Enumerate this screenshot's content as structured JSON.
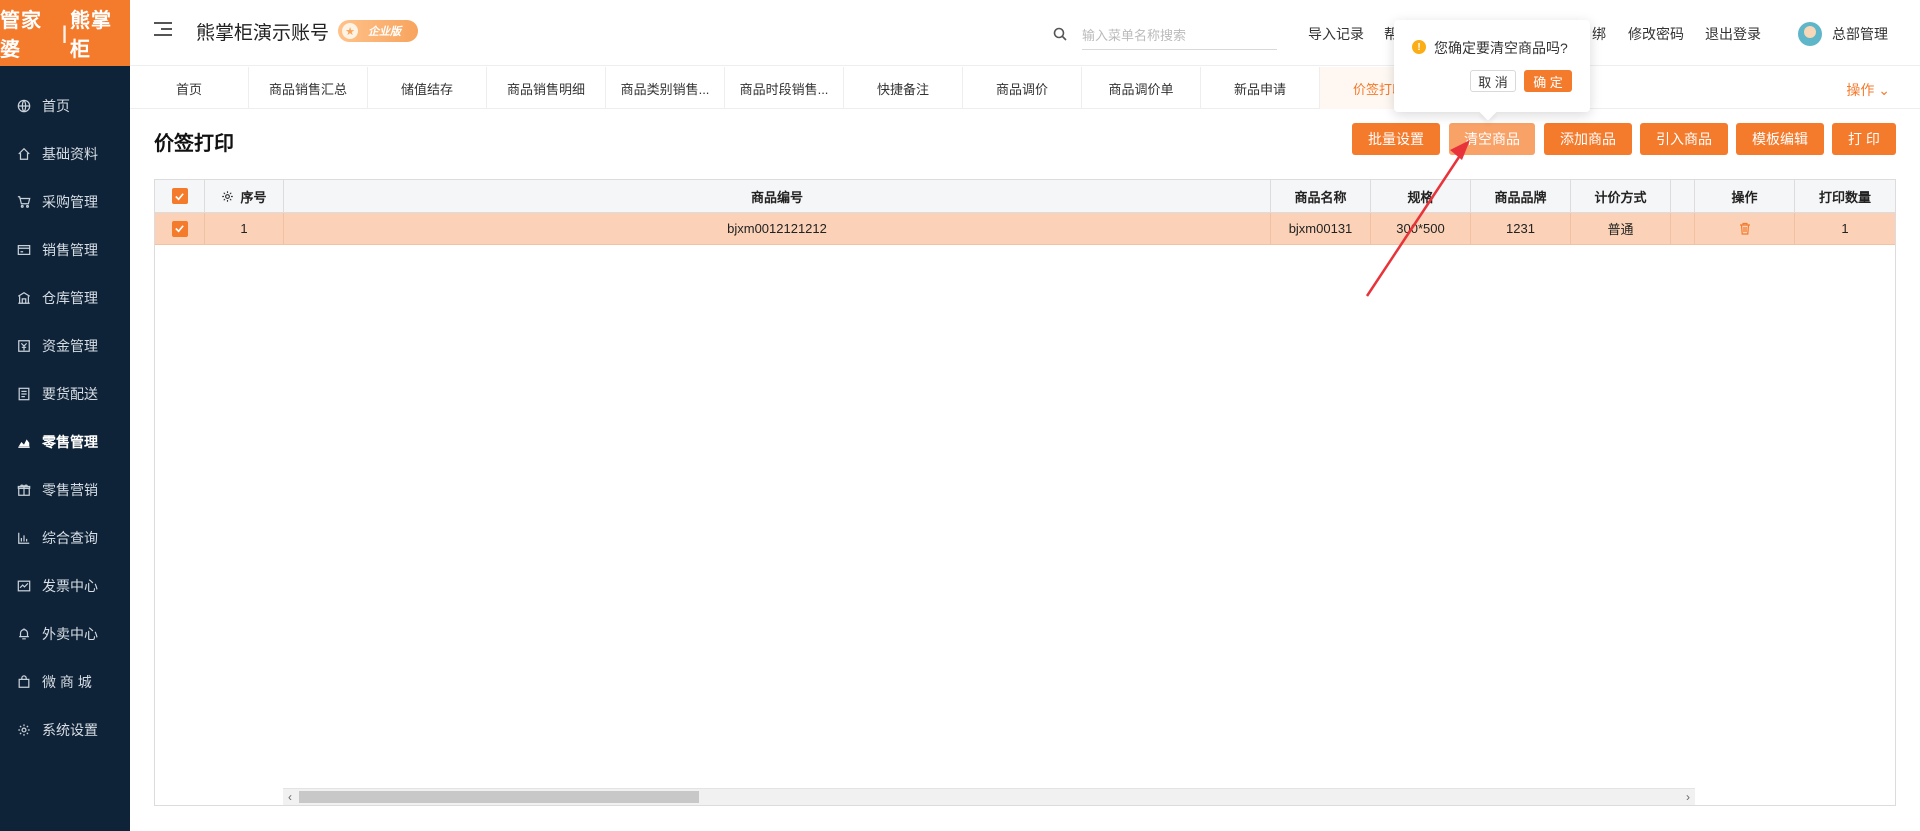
{
  "brand": {
    "logo_left": "管家婆",
    "logo_right": "熊掌柜"
  },
  "sidebar": {
    "items": [
      {
        "label": "首页",
        "icon": "globe-icon",
        "active": false
      },
      {
        "label": "基础资料",
        "icon": "home-icon",
        "active": false
      },
      {
        "label": "采购管理",
        "icon": "cart-icon",
        "active": false
      },
      {
        "label": "销售管理",
        "icon": "card-icon",
        "active": false
      },
      {
        "label": "仓库管理",
        "icon": "warehouse-icon",
        "active": false
      },
      {
        "label": "资金管理",
        "icon": "money-icon",
        "active": false
      },
      {
        "label": "要货配送",
        "icon": "list-icon",
        "active": false
      },
      {
        "label": "零售管理",
        "icon": "chart-icon",
        "active": true
      },
      {
        "label": "零售营销",
        "icon": "gift-icon",
        "active": false
      },
      {
        "label": "综合查询",
        "icon": "bar-chart-icon",
        "active": false
      },
      {
        "label": "发票中心",
        "icon": "trend-icon",
        "active": false
      },
      {
        "label": "外卖中心",
        "icon": "bell-icon",
        "active": false
      },
      {
        "label": "微 商 城",
        "icon": "bag-icon",
        "active": false
      },
      {
        "label": "系统设置",
        "icon": "gear-icon",
        "active": false
      }
    ]
  },
  "header": {
    "account_title": "熊掌柜演示账号",
    "badge": "企业版",
    "search_placeholder": "输入菜单名称搜索",
    "links": {
      "import": "导入记录",
      "help": "帮",
      "unbind": "绑",
      "change_password": "修改密码",
      "logout": "退出登录"
    },
    "user_name": "总部管理"
  },
  "tabs": {
    "items": [
      "首页",
      "商品销售汇总",
      "储值结存",
      "商品销售明细",
      "商品类别销售...",
      "商品时段销售...",
      "快捷备注",
      "商品调价",
      "商品调价单",
      "新品申请",
      "价签打印"
    ],
    "active_index": 10,
    "operations": "操作"
  },
  "page": {
    "title": "价签打印",
    "buttons": [
      "批量设置",
      "清空商品",
      "添加商品",
      "引入商品",
      "模板编辑",
      "打 印"
    ]
  },
  "table": {
    "columns": [
      "",
      "序号",
      "商品编号",
      "商品名称",
      "规格",
      "商品品牌",
      "计价方式",
      "",
      "操作",
      "打印数量"
    ],
    "rows": [
      {
        "index": "1",
        "code": "bjxm0012121212",
        "name": "bjxm00131",
        "spec": "300*500",
        "brand": "1231",
        "pricing": "普通",
        "print_qty": "1",
        "checked": true
      }
    ]
  },
  "popconfirm": {
    "message": "您确定要清空商品吗?",
    "cancel": "取 消",
    "ok": "确 定"
  },
  "colors": {
    "accent": "#f47a2c",
    "sidebar": "#0f2338",
    "row_selected": "#fbd2b7",
    "annotation_arrow": "#e8333b"
  }
}
